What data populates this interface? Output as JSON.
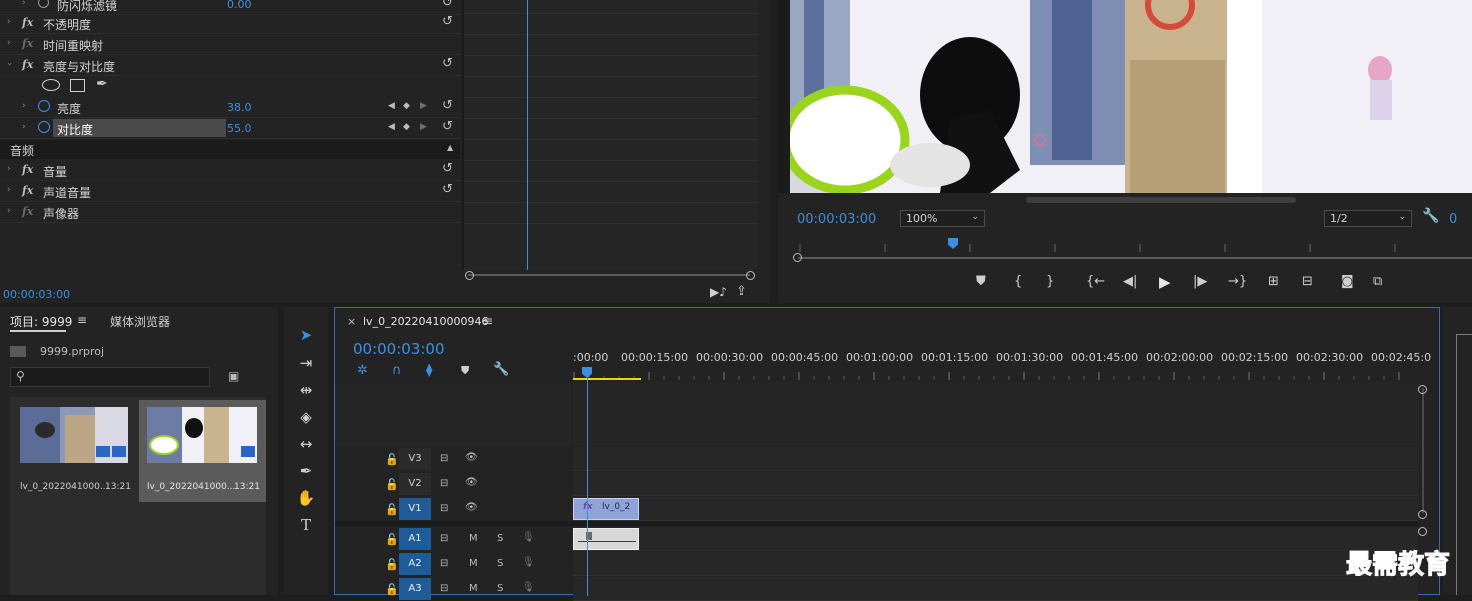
{
  "effect_controls": {
    "rows": [
      {
        "label": "防闪烁滤镜",
        "value": "0.00",
        "type": "prop"
      },
      {
        "label": "不透明度",
        "type": "fx"
      },
      {
        "label": "时间重映射",
        "type": "fx-dim"
      },
      {
        "label": "亮度与对比度",
        "type": "fx-open"
      },
      {
        "label": "亮度",
        "value": "38.0",
        "type": "param"
      },
      {
        "label": "对比度",
        "value": "55.0",
        "type": "param-selected"
      }
    ],
    "audio_section": "音频",
    "audio_rows": [
      {
        "label": "音量",
        "type": "fx"
      },
      {
        "label": "声道音量",
        "type": "fx"
      },
      {
        "label": "声像器",
        "type": "fx-dim"
      }
    ],
    "timecode": "00:00:03:00"
  },
  "program_monitor": {
    "timecode": "00:00:03:00",
    "zoom": "100%",
    "resolution": "1/2"
  },
  "project": {
    "tab_project": "项目: 9999",
    "tab_media": "媒体浏览器",
    "file": "9999.prproj",
    "search_placeholder": "",
    "items": [
      {
        "name": "lv_0_2022041000...",
        "duration": "13:21"
      },
      {
        "name": "lv_0_2022041000...",
        "duration": "13:21"
      }
    ]
  },
  "timeline": {
    "sequence_name": "lv_0_20220410000946",
    "timecode": "00:00:03:00",
    "ruler": [
      ":00:00",
      "00:00:15:00",
      "00:00:30:00",
      "00:00:45:00",
      "00:01:00:00",
      "00:01:15:00",
      "00:01:30:00",
      "00:01:45:00",
      "00:02:00:00",
      "00:02:15:00",
      "00:02:30:00",
      "00:02:45:0"
    ],
    "video_tracks": [
      "V3",
      "V2",
      "V1"
    ],
    "audio_tracks": [
      "A1",
      "A2",
      "A3"
    ],
    "track_target": "V1",
    "mute_label": "M",
    "solo_label": "S",
    "clip_label": "lv_0_2",
    "clip_fx": "fx"
  },
  "watermark": "最需教育"
}
